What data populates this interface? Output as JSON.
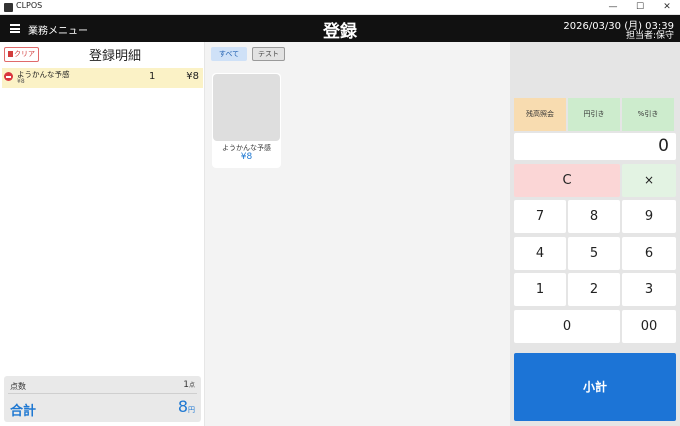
{
  "window": {
    "title": "CLPOS",
    "minimize_icon": "minimize-icon",
    "maximize_icon": "maximize-icon",
    "close_icon": "close-icon",
    "minimize_glyph": "—",
    "maximize_glyph": "☐",
    "close_glyph": "✕"
  },
  "header": {
    "menu_icon": "hamburger-menu-icon",
    "menu_label": "業務メニュー",
    "title": "登録",
    "datetime": "2026/03/30 (月) 03:39",
    "operator": "担当者:保守",
    "background": "#111111"
  },
  "details": {
    "clear_label": "クリア",
    "clear_icon": "trash-icon",
    "title": "登録明細",
    "items": [
      {
        "remove_icon": "remove-circle-icon",
        "name": "ようかんな予感",
        "unit_price": "¥8",
        "qty": "1",
        "amount": "¥8",
        "highlight": "#fbf2c6"
      }
    ],
    "count_label": "点数",
    "count_value": "1",
    "count_unit": "点",
    "total_label": "合計",
    "total_value": "8",
    "total_unit": "円",
    "accent": "#1e78d2"
  },
  "products": {
    "tabs": [
      {
        "label": "すべて",
        "selected": true
      },
      {
        "label": "テスト",
        "selected": false
      }
    ],
    "items": [
      {
        "name": "ようかんな予感",
        "price": "¥8"
      }
    ]
  },
  "keypad": {
    "balance_label": "残高照会",
    "yen_discount_label": "円引き",
    "pct_discount_label": "%引き",
    "display_value": "0",
    "clear_label": "C",
    "multiply_label": "×",
    "digits": [
      "7",
      "8",
      "9",
      "4",
      "5",
      "6",
      "1",
      "2",
      "3"
    ],
    "zero_label": "0",
    "double_zero_label": "00",
    "subtotal_label": "小計",
    "subtotal_color": "#1c74d6"
  }
}
